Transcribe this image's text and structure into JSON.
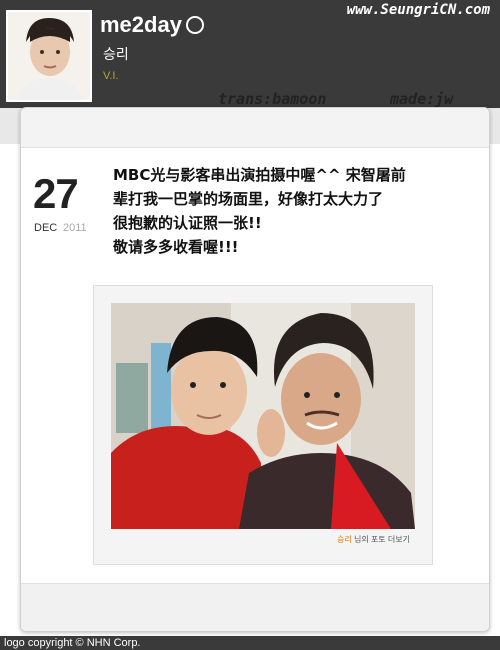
{
  "header": {
    "watermark": "www.SeungriCN.com",
    "brand": "me2day",
    "user_name": "승리",
    "user_level": "V.I.",
    "credit_trans": "trans:bamoon",
    "credit_made": "made:jw"
  },
  "post": {
    "day": "27",
    "month": "DEC",
    "year": "2011",
    "text_lines": [
      "MBC光与影客串出演拍摄中喔^^ 宋智屠前",
      "辈打我一巴掌的场面里，好像打太大力了",
      "很抱歉的认证照一张!!",
      "敬请多多收看喔!!!"
    ],
    "photo_link_user": "승리",
    "photo_link_text": " 님의 포토 더보기"
  },
  "footer": {
    "copyright": "logo copyright © NHN Corp."
  },
  "colors": {
    "top_bar": "#3a3a3a",
    "accent_orange": "#e07a00",
    "level_gold": "#b9a22c"
  }
}
